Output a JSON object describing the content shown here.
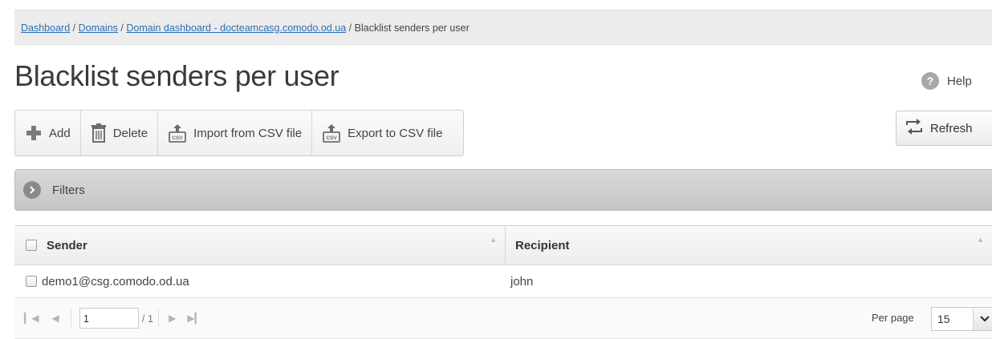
{
  "breadcrumb": {
    "items": [
      "Dashboard",
      "Domains",
      "Domain dashboard - docteamcasg.comodo.od.ua"
    ],
    "separator": "/",
    "current": "Blacklist senders per user"
  },
  "page": {
    "title": "Blacklist senders per user"
  },
  "help": {
    "label": "Help",
    "icon": "help-icon"
  },
  "toolbar": {
    "add_label": "Add",
    "delete_label": "Delete",
    "import_label": "Import from CSV file",
    "export_label": "Export to CSV file",
    "refresh_label": "Refresh"
  },
  "filters": {
    "label": "Filters"
  },
  "table": {
    "columns": [
      "Sender",
      "Recipient"
    ],
    "rows": [
      {
        "sender": "demo1@csg.comodo.od.ua",
        "recipient": "john"
      }
    ]
  },
  "pagination": {
    "current_page": "1",
    "total": "/ 1",
    "per_page_label": "Per page",
    "per_page_value": "15"
  },
  "colors": {
    "link": "#2a6fb5",
    "add_icon": "#7a7a7a",
    "filters_bar": "#cfcfcf"
  }
}
